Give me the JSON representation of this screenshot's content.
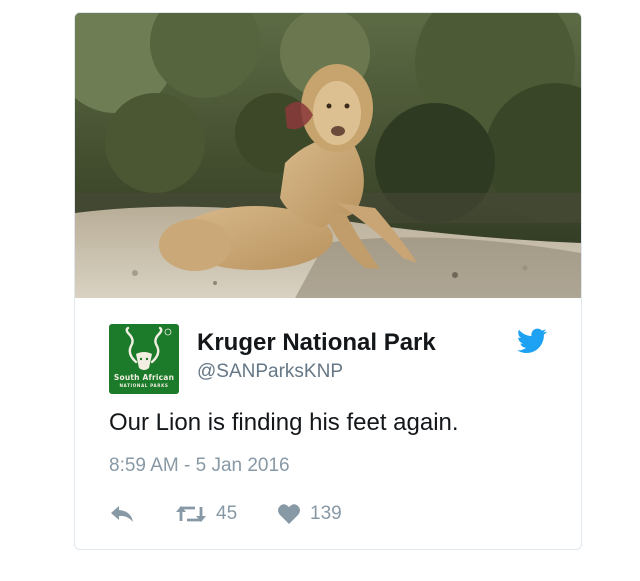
{
  "tweet": {
    "photo": {
      "icon": "lion-photo",
      "alt": ""
    },
    "author": {
      "name": "Kruger National Park",
      "handle": "@SANParksKNP",
      "avatar": {
        "icon": "kudu-logo-icon",
        "brand_line1": "South African",
        "brand_line2": "NATIONAL PARKS",
        "bg_color": "#1c7a2b"
      }
    },
    "brand_icon": "twitter-bird-icon",
    "text": "Our Lion is finding his feet again.",
    "timestamp": "8:59 AM - 5 Jan 2016",
    "actions": {
      "reply": {
        "icon": "reply-icon"
      },
      "retweet": {
        "icon": "retweet-icon",
        "count": "45"
      },
      "like": {
        "icon": "heart-icon",
        "count": "139"
      }
    },
    "colors": {
      "twitter_blue": "#1da1f2",
      "muted": "#8899a6",
      "text": "#14171a"
    }
  }
}
